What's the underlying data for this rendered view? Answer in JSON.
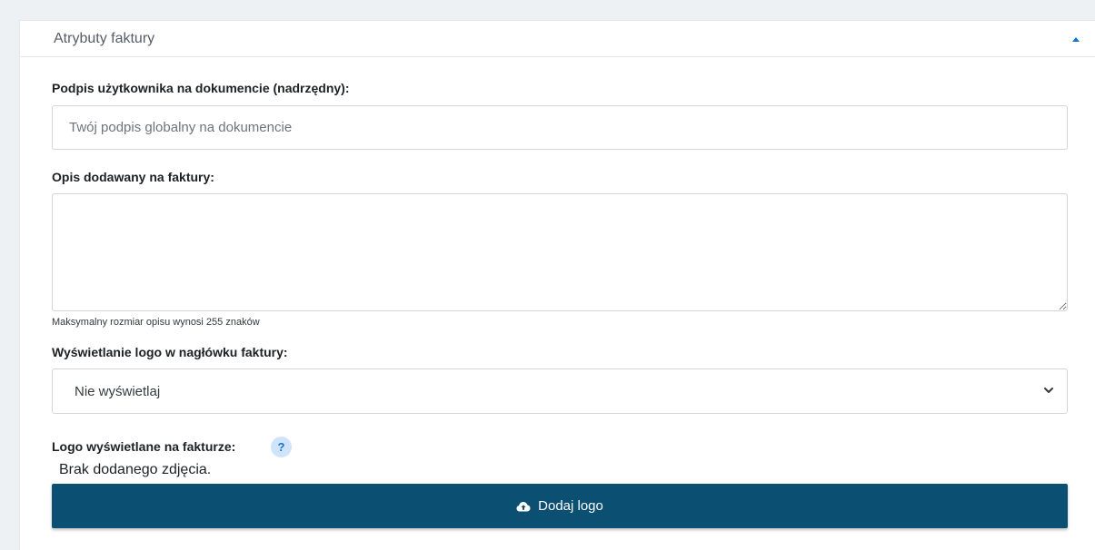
{
  "section": {
    "title": "Atrybuty faktury"
  },
  "signature": {
    "label": "Podpis użytkownika na dokumencie (nadrzędny):",
    "placeholder": "Twój podpis globalny na dokumencie",
    "value": ""
  },
  "description": {
    "label": "Opis dodawany na faktury:",
    "value": "",
    "helper": "Maksymalny rozmiar opisu wynosi 255 znaków"
  },
  "logo_display": {
    "label": "Wyświetlanie logo w nagłówku faktury:",
    "selected": "Nie wyświetlaj"
  },
  "logo": {
    "label": "Logo wyświetlane na fakturze:",
    "help_symbol": "?",
    "empty_text": "Brak dodanego zdjęcia.",
    "button_label": "Dodaj logo",
    "button_icon": "cloud-upload-icon"
  },
  "colors": {
    "button_bg": "#0b4f73",
    "accent": "#1a73c8"
  }
}
